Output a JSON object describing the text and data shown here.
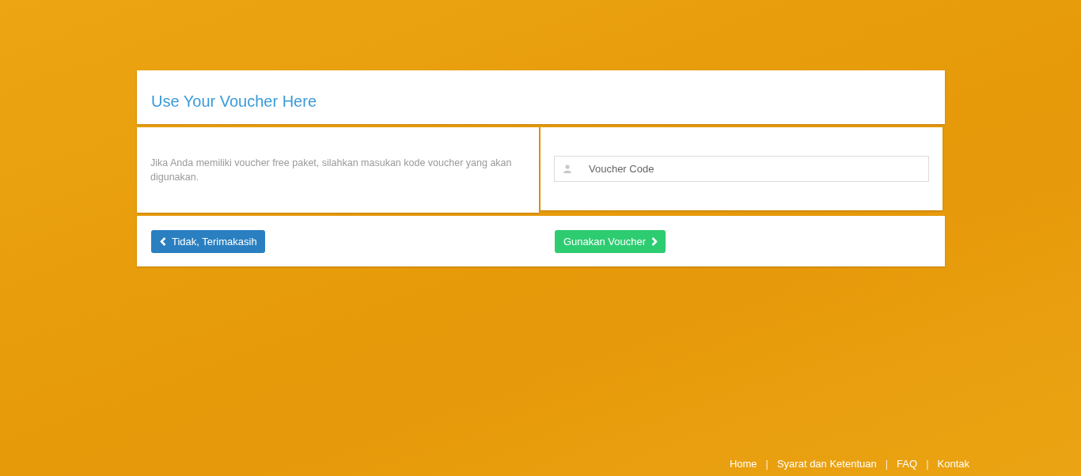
{
  "card": {
    "title": "Use Your Voucher Here",
    "description": "Jika Anda memiliki voucher free paket, silahkan masukan kode voucher yang akan digunakan.",
    "voucher_field": {
      "placeholder": "Voucher Code"
    },
    "buttons": [
      {
        "kind": "back",
        "label": "Tidak, Terimakasih"
      },
      {
        "kind": "submit",
        "label": "Gunakan Voucher"
      }
    ]
  },
  "footer": [
    {
      "kind": "link",
      "label": "Home"
    },
    {
      "kind": "separator",
      "label": "|"
    },
    {
      "kind": "link",
      "label": "Syarat dan Ketentuan"
    },
    {
      "kind": "separator",
      "label": "|"
    },
    {
      "kind": "link",
      "label": "FAQ"
    },
    {
      "kind": "separator",
      "label": "|"
    },
    {
      "kind": "link",
      "label": "Kontak"
    }
  ]
}
